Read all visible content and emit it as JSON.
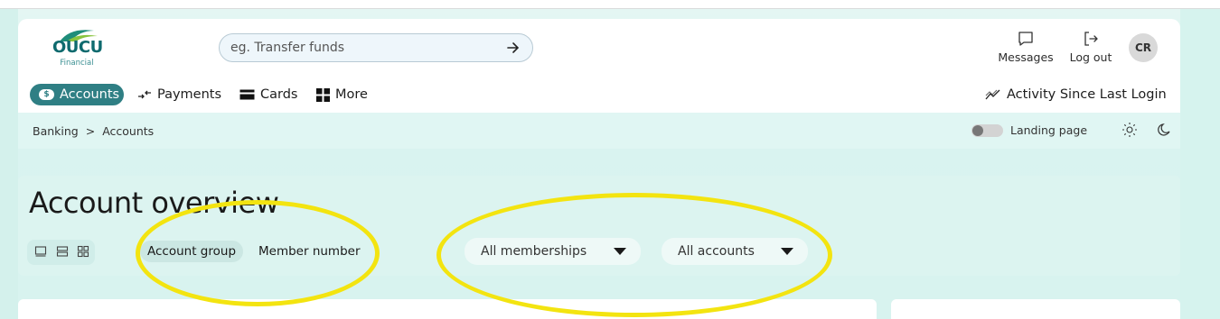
{
  "brand": {
    "logo_text": "OUCU",
    "logo_sub": "Financial"
  },
  "search": {
    "placeholder": "eg. Transfer funds"
  },
  "header_actions": {
    "messages": "Messages",
    "logout": "Log out",
    "avatar_initials": "CR"
  },
  "nav": {
    "accounts": "Accounts",
    "accounts_badge": "$",
    "payments": "Payments",
    "cards": "Cards",
    "more": "More",
    "activity": "Activity Since Last Login"
  },
  "breadcrumb": {
    "root": "Banking",
    "separator": ">",
    "current": "Accounts"
  },
  "landing_toggle": {
    "label": "Landing page",
    "enabled": false
  },
  "overview": {
    "title": "Account overview",
    "segments": [
      "Account group",
      "Member number"
    ],
    "active_segment": "Account group",
    "filters": {
      "memberships": "All memberships",
      "accounts": "All accounts"
    }
  },
  "colors": {
    "accent": "#2f7f84",
    "annotation": "#f3e410",
    "background": "#d9f3f0"
  }
}
